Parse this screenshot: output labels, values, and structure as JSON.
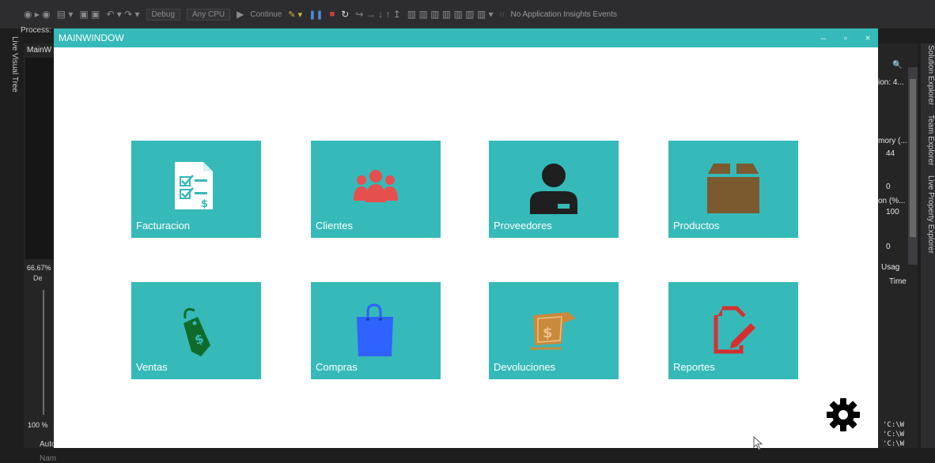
{
  "vs": {
    "toolbar": {
      "config": "Debug",
      "platform": "Any CPU",
      "continue": "Continue",
      "insights": "No Application Insights Events"
    },
    "process_label": "Process:",
    "live_visual_tree": "Live Visual Tree",
    "left_tab": "MainW",
    "left_zoom": "66.67%",
    "left_de": "De",
    "left_zoom2": "100 %",
    "autos": "Autos",
    "autos_name": "Nam",
    "right": {
      "ion": "ion: 4...",
      "mory": "mory (...",
      "v44": "44",
      "v0a": "0",
      "on": "on (%...",
      "v100": "100",
      "v0b": "0",
      "usage": "Usag",
      "time": "Time",
      "path1": "'C:\\W",
      "path2": "'C:\\W",
      "path3": "'C:\\W"
    },
    "right_tabs": [
      "Solution Explorer",
      "Team Explorer",
      "Live Property Explorer"
    ]
  },
  "window": {
    "title": "MAINWINDOW",
    "controls": [
      "–",
      "▫",
      "×"
    ]
  },
  "tiles": [
    {
      "label": "Facturacion",
      "icon": "invoice-checklist-icon"
    },
    {
      "label": "Clientes",
      "icon": "users-group-icon"
    },
    {
      "label": "Proveedores",
      "icon": "supplier-person-icon"
    },
    {
      "label": "Productos",
      "icon": "product-box-icon"
    },
    {
      "label": "Ventas",
      "icon": "price-tag-icon"
    },
    {
      "label": "Compras",
      "icon": "shopping-bag-icon"
    },
    {
      "label": "Devoluciones",
      "icon": "money-return-icon"
    },
    {
      "label": "Reportes",
      "icon": "report-edit-icon"
    }
  ],
  "colors": {
    "tile": "#36b9b9",
    "titlebar": "#35b9b9",
    "clientes": "#e5504f",
    "proveedores": "#1f1f1f",
    "productos": "#7a5a2e",
    "ventas": "#0e6b2a",
    "compras": "#2f62ff",
    "devoluciones": "#c98a3c",
    "reportes": "#d62f2f"
  }
}
